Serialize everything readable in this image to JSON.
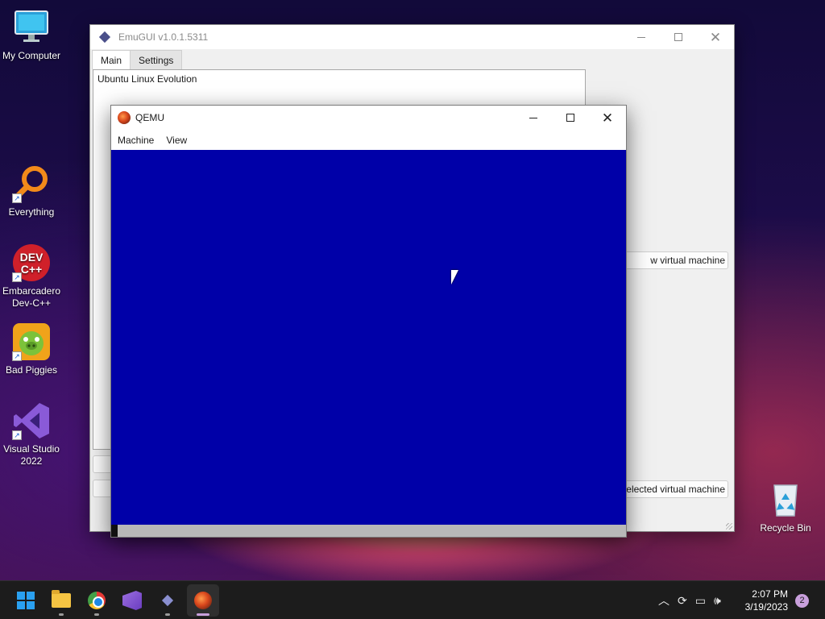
{
  "desktop": {
    "icons": [
      {
        "label": "My Computer",
        "icon": "monitor-icon"
      },
      {
        "label": "Everything",
        "icon": "magnifier-icon"
      },
      {
        "label": "Embarcadero Dev-C++",
        "icon": "devcpp-icon",
        "badge": "DEV C++"
      },
      {
        "label": "Bad Piggies",
        "icon": "bad-piggies-icon"
      },
      {
        "label": "Visual Studio 2022",
        "icon": "visual-studio-icon"
      },
      {
        "label": "Recycle Bin",
        "icon": "recycle-bin-icon"
      }
    ]
  },
  "emugui": {
    "title": "EmuGUI v1.0.1.5311",
    "tabs": [
      "Main",
      "Settings"
    ],
    "vm_list": [
      "Ubuntu Linux Evolution"
    ],
    "buttons": {
      "new_vm": "w virtual machine",
      "start_vm": "elected virtual machine"
    }
  },
  "qemu": {
    "title": "QEMU",
    "menu": [
      "Machine",
      "View"
    ],
    "screen_color": "#0000a8"
  },
  "taskbar": {
    "apps": [
      "start-icon",
      "file-explorer-icon",
      "chrome-icon",
      "visual-studio-icon",
      "emugui-icon",
      "qemu-icon"
    ],
    "active_app": "qemu-icon",
    "tray": {
      "time": "2:07 PM",
      "date": "3/19/2023",
      "notifications": "2"
    }
  },
  "colors": {
    "qemu_screen": "#0000a8",
    "taskbar": "#1c1c1c",
    "accent": "#c9a0dc"
  }
}
